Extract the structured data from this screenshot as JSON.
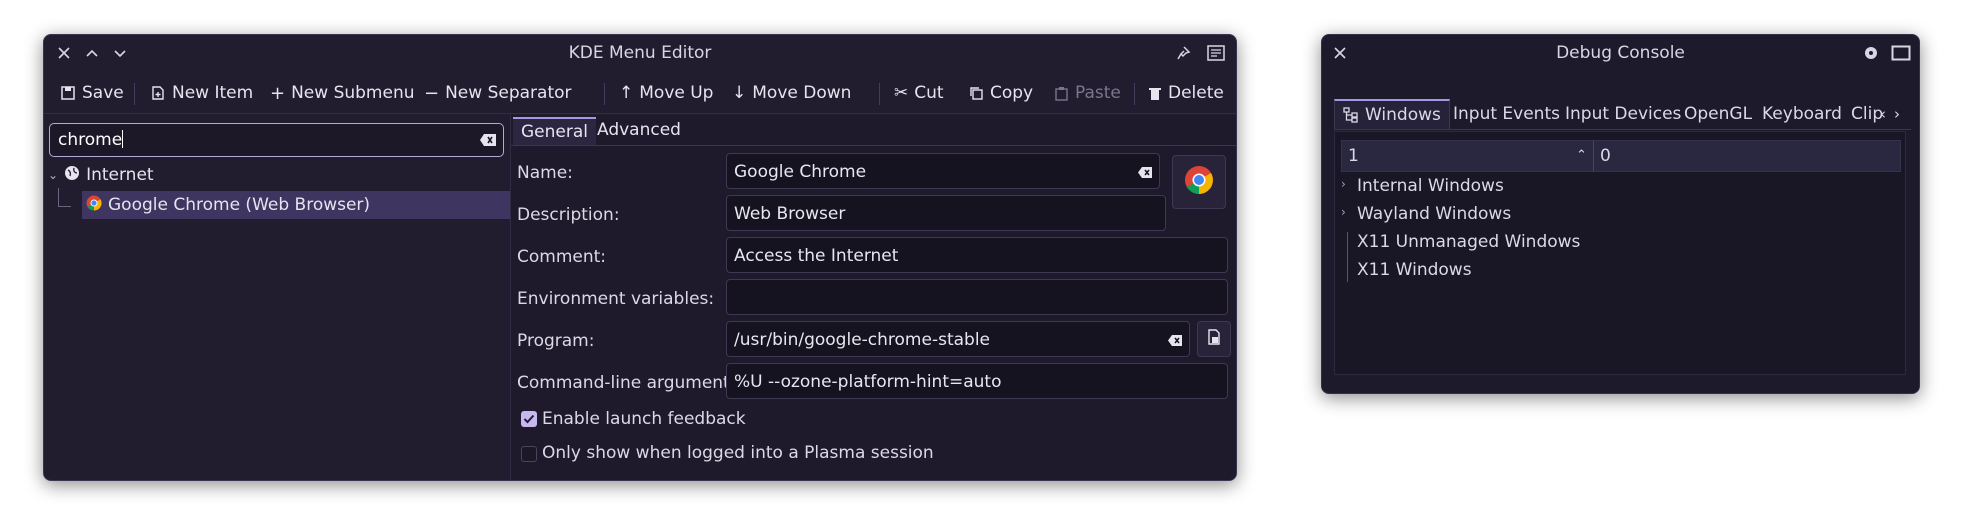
{
  "menu_editor": {
    "title": "KDE Menu Editor",
    "toolbar": {
      "save": "Save",
      "new_item": "New Item",
      "new_submenu": "New Submenu",
      "new_separator": "New Separator",
      "move_up": "Move Up",
      "move_down": "Move Down",
      "cut": "Cut",
      "copy": "Copy",
      "paste": "Paste",
      "delete": "Delete"
    },
    "search": {
      "value": "chrome"
    },
    "tree": {
      "category": "Internet",
      "item": "Google Chrome (Web Browser)"
    },
    "tabs": {
      "general": "General",
      "advanced": "Advanced"
    },
    "form": {
      "name_label": "Name:",
      "name_value": "Google Chrome",
      "description_label": "Description:",
      "description_value": "Web Browser",
      "comment_label": "Comment:",
      "comment_value": "Access the Internet",
      "env_label": "Environment variables:",
      "env_value": "",
      "program_label": "Program:",
      "program_value": "/usr/bin/google-chrome-stable",
      "args_label": "Command-line arguments:",
      "args_value": "%U --ozone-platform-hint=auto",
      "launch_feedback_label": "Enable launch feedback",
      "launch_feedback_checked": true,
      "plasma_only_label": "Only show when logged into a Plasma session",
      "plasma_only_checked": false
    }
  },
  "debug_console": {
    "title": "Debug Console",
    "tabs": [
      "Windows",
      "Input Events",
      "Input Devices",
      "OpenGL",
      "Keyboard",
      "Clip"
    ],
    "columns": [
      "1",
      "0"
    ],
    "rows": [
      "Internal Windows",
      "Wayland Windows",
      "X11 Unmanaged Windows",
      "X11 Windows"
    ]
  },
  "colors": {
    "window_bg": "#211c2e",
    "accent": "#a996e0",
    "selection": "#3e3560"
  }
}
